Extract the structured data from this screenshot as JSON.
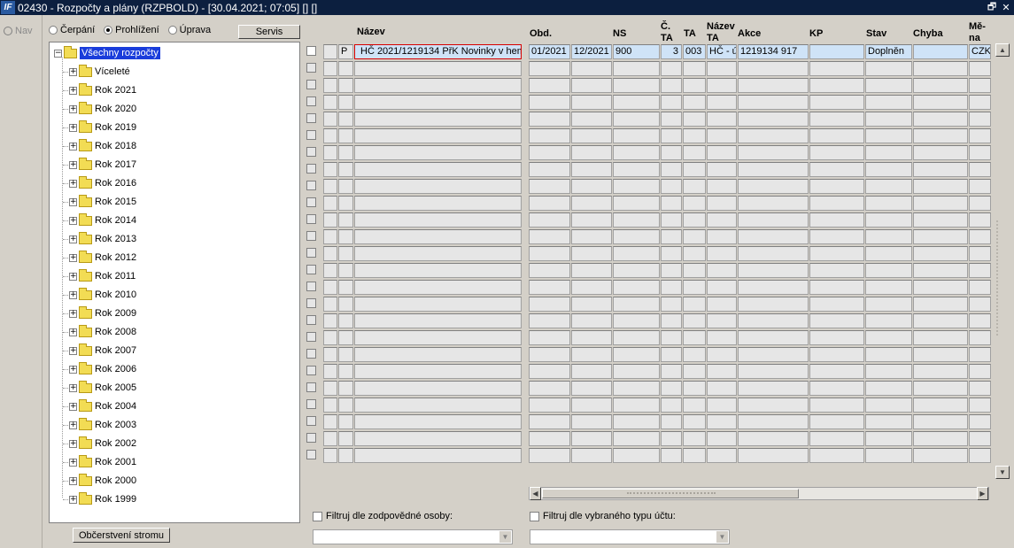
{
  "window": {
    "icon_text": "IF",
    "title": "02430 - Rozpočty a plány (RZPBOLD) - [30.04.2021; 07:05] [] []",
    "restore_glyph": "🗗",
    "close_glyph": "✕"
  },
  "nav": {
    "label": "Nav"
  },
  "modes": {
    "cerpani": "Čerpání",
    "prohlizeni": "Prohlížení",
    "uprava": "Úprava",
    "selected": "prohlizeni"
  },
  "servis_label": "Servis",
  "tree": {
    "root": "Všechny rozpočty",
    "items": [
      "Víceleté",
      "Rok 2021",
      "Rok 2020",
      "Rok 2019",
      "Rok 2018",
      "Rok 2017",
      "Rok 2016",
      "Rok 2015",
      "Rok 2014",
      "Rok 2013",
      "Rok 2012",
      "Rok 2011",
      "Rok 2010",
      "Rok 2009",
      "Rok 2008",
      "Rok 2007",
      "Rok 2006",
      "Rok 2005",
      "Rok 2004",
      "Rok 2003",
      "Rok 2002",
      "Rok 2001",
      "Rok 2000",
      "Rok 1999"
    ]
  },
  "refresh_label": "Občerstvení stromu",
  "grid": {
    "headers": {
      "nazev": "Název",
      "obd": "Obd.",
      "ns": "NS",
      "cta_1": "Č.",
      "cta_2": "TA",
      "ta": "TA",
      "nazevta_1": "Název",
      "nazevta_2": "TA",
      "akce": "Akce",
      "kp": "KP",
      "stav": "Stav",
      "chyba": "Chyba",
      "mena_1": "Mě-",
      "mena_2": "na"
    },
    "row1": {
      "flag": "P",
      "nazev": "HČ 2021/1219134 PřK Novinky v hem",
      "obd_od": "01/2021",
      "obd_do": "12/2021",
      "ns": "900",
      "cta": "3",
      "ta": "003",
      "nazev_ta": "HČ - ú",
      "akce": "1219134 917",
      "kp": "",
      "stav": "Doplněn",
      "chyba": "",
      "mena": "CZK"
    }
  },
  "filters": {
    "osoba_label": "Filtruj dle zodpovědné osoby:",
    "ucet_label": "Filtruj dle vybraného typu účtu:"
  },
  "glyphs": {
    "up": "▲",
    "down": "▼",
    "left": "◀",
    "right": "▶",
    "combo": "▼",
    "plus": "+",
    "minus": "−"
  }
}
